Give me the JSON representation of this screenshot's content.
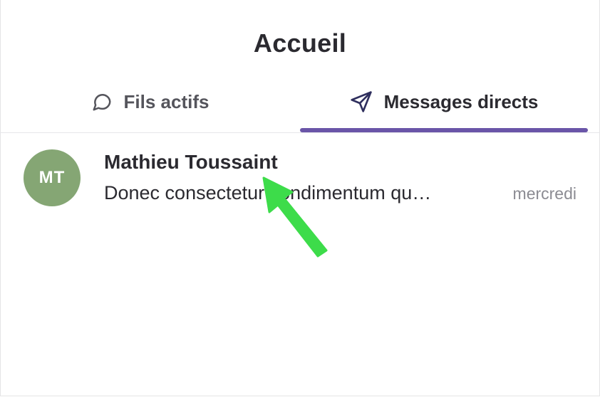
{
  "header": {
    "title": "Accueil"
  },
  "tabs": [
    {
      "label": "Fils actifs",
      "icon": "chat-bubble-icon",
      "active": false
    },
    {
      "label": "Messages directs",
      "icon": "paper-plane-icon",
      "active": true
    }
  ],
  "colors": {
    "accent": "#6a55a8",
    "avatar_bg": "#85a674",
    "cursor_arrow": "#3ddc4a"
  },
  "conversations": [
    {
      "avatar_initials": "MT",
      "name": "Mathieu Toussaint",
      "preview": "Donec consectetur condimentum qu…",
      "time": "mercredi"
    }
  ],
  "overlay": {
    "icon": "green-pointer-arrow-icon"
  }
}
